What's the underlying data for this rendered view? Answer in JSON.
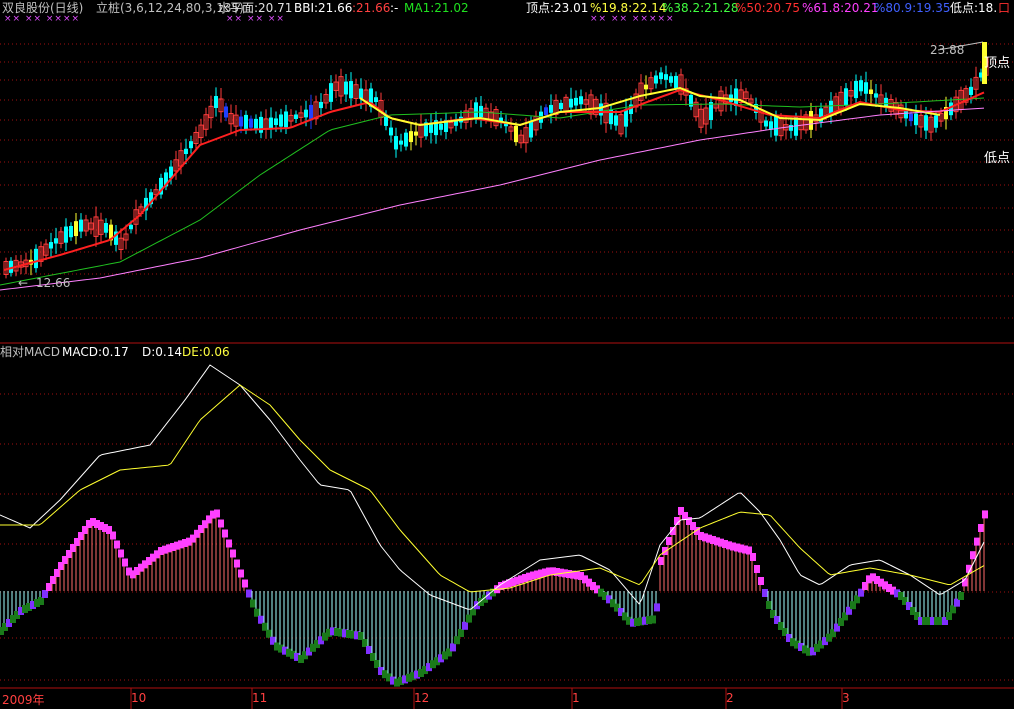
{
  "header": {
    "stock_title": "双良股份(日线)",
    "indicator_name": "立桩(3,6,12,24,80,3,135)",
    "water_label": "水平面:20.71",
    "bbi_label": "BBI:21.66",
    "bbi2_label": ":21.66",
    "dash_label": ":-",
    "ma1_label": "MA1:21.02",
    "top_point": "顶点:23.01",
    "fib_19": "%19.8:22.14",
    "fib_38": "%38.2:21.28",
    "fib_50": "%50:20.75",
    "fib_61": "%61.8:20.21",
    "fib_80": "%80.9:19.35",
    "low_point": "低点:18.",
    "box_glyph": "口"
  },
  "price_panel": {
    "high_value": "23.88",
    "low_value": "12.66",
    "top_point_label": "顶点",
    "low_point_label": "低点",
    "arrow": "←",
    "x_marks_left": "×× ×× ××××",
    "x_marks_mid": "×× ×× ××",
    "x_marks_right": "×× ×× ×××××"
  },
  "macd_panel": {
    "title": "相对MACD",
    "macd_label": "MACD:0.17",
    "d_label": "D:0.14",
    "de_label": "DE:0.06"
  },
  "time_axis": {
    "labels": [
      "2009年",
      "10",
      "11",
      "12",
      "1",
      "2",
      "3"
    ]
  },
  "colors": {
    "up": "#ff3c3c",
    "down": "#00ffff",
    "ma_red": "#ff2020",
    "ma_green": "#20c020",
    "ma_yellow": "#ffff30",
    "long_ma": "#ff80ff",
    "grid": "#a01010",
    "macd_pos": "#ff40ff",
    "macd_neg": "#1a7a1a"
  }
}
